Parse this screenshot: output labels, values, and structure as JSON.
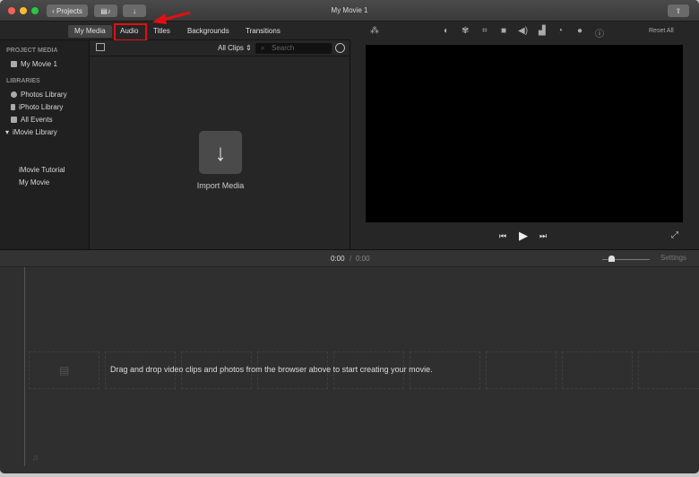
{
  "window": {
    "title": "My Movie 1",
    "projects_button": "Projects"
  },
  "tabs": [
    {
      "label": "My Media",
      "active": true
    },
    {
      "label": "Audio",
      "active": false,
      "highlighted": true
    },
    {
      "label": "Titles"
    },
    {
      "label": "Backgrounds"
    },
    {
      "label": "Transitions"
    }
  ],
  "sidebar": {
    "project_media_header": "PROJECT MEDIA",
    "project_item": "My Movie 1",
    "libraries_header": "LIBRARIES",
    "libraries": [
      "Photos Library",
      "iPhoto Library",
      "All Events"
    ],
    "imovie_library": "iMovie Library",
    "events": [
      "iMovie Tutorial",
      "My Movie"
    ]
  },
  "browser": {
    "filter": "All Clips",
    "search_placeholder": "Search",
    "import_label": "Import Media"
  },
  "viewer": {
    "reset_all": "Reset All"
  },
  "timeline": {
    "current_time": "0:00",
    "separator": "/",
    "total_time": "0:00",
    "settings": "Settings",
    "hint": "Drag and drop video clips and photos from the browser above to start creating your movie."
  },
  "colors": {
    "highlight": "#e01010",
    "background": "#2b2b2b"
  }
}
